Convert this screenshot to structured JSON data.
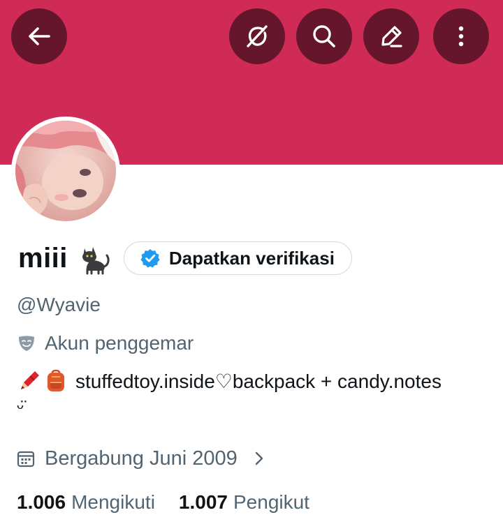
{
  "header": {
    "banner_color": "#d02b57",
    "button_color": "#65152c",
    "buttons": [
      {
        "icon": "back-arrow-icon"
      },
      {
        "icon": "grok-icon"
      },
      {
        "icon": "search-icon"
      },
      {
        "icon": "edit-icon"
      },
      {
        "icon": "more-options-icon"
      }
    ]
  },
  "profile": {
    "display_name": "miii",
    "name_emoji": "cat-emoji",
    "verify_button_label": "Dapatkan verifikasi",
    "verify_badge_color": "#1d9bf0",
    "handle": "@Wyavie",
    "category_icon": "theater-masks-icon",
    "category": "Akun penggemar",
    "bio_emojis": [
      "crayon-emoji",
      "backpack-emoji"
    ],
    "bio_text": "stuffedtoy.inside♡backpack + candy.notes",
    "bio_tail": "ᵕ̈",
    "joined_icon": "calendar-icon",
    "joined": "Bergabung Juni 2009"
  },
  "stats": {
    "following_count": "1.006",
    "following_label": "Mengikuti",
    "followers_count": "1.007",
    "followers_label": "Pengikut"
  },
  "colors": {
    "text_primary": "#0f1419",
    "text_secondary": "#536471",
    "border": "#cfd9de"
  }
}
